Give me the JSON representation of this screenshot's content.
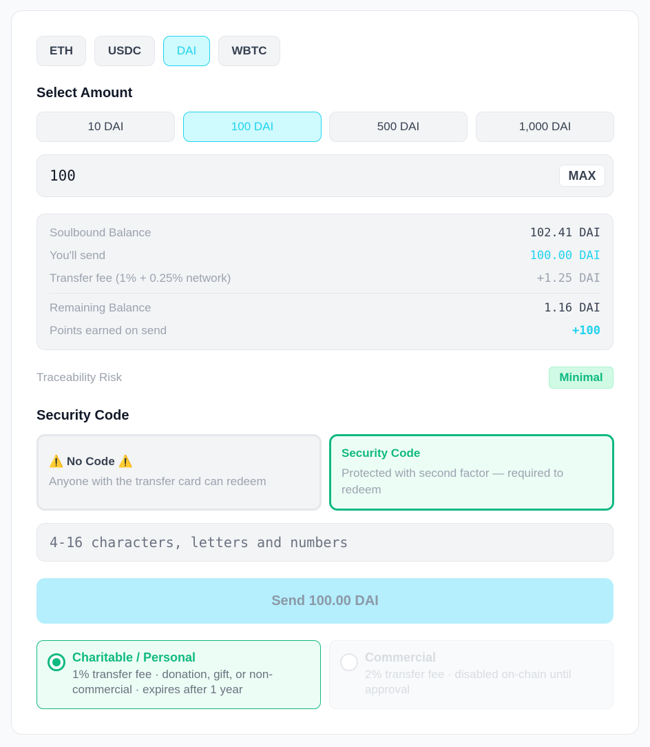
{
  "tokens": [
    "ETH",
    "USDC",
    "DAI",
    "WBTC"
  ],
  "select_amount_heading": "Select Amount",
  "amount_presets": [
    "10 DAI",
    "100 DAI",
    "500 DAI",
    "1,000 DAI"
  ],
  "amount_input": {
    "value": "100",
    "max_label": "MAX"
  },
  "summary": {
    "balance_label": "Soulbound Balance",
    "balance_value": "102.41 DAI",
    "send_label": "You'll send",
    "send_value": "100.00 DAI",
    "fee_label": "Transfer fee (1% + 0.25% network)",
    "fee_value": "+1.25 DAI",
    "remaining_label": "Remaining Balance",
    "remaining_value": "1.16 DAI",
    "points_label": "Points earned on send",
    "points_value": "+100"
  },
  "risk": {
    "label": "Traceability Risk",
    "badge": "Minimal"
  },
  "security_heading": "Security Code",
  "no_code": {
    "title": "⚠️ No Code ⚠️",
    "desc": "Anyone with the transfer card can redeem"
  },
  "secure_code": {
    "title": "Security Code",
    "desc": "Protected with second factor — required to redeem"
  },
  "code_input_placeholder": "4-16 characters, letters and numbers",
  "send_button": "Send 100.00 DAI",
  "usage": {
    "charity": {
      "title": "Charitable / Personal",
      "desc": "1% transfer fee · donation, gift, or non-commercial · expires after 1 year"
    },
    "commercial": {
      "title": "Commercial",
      "desc": "2% transfer fee · disabled on-chain until approval"
    }
  },
  "colors": {
    "accent": "#22d3ee",
    "success": "#10b981"
  }
}
